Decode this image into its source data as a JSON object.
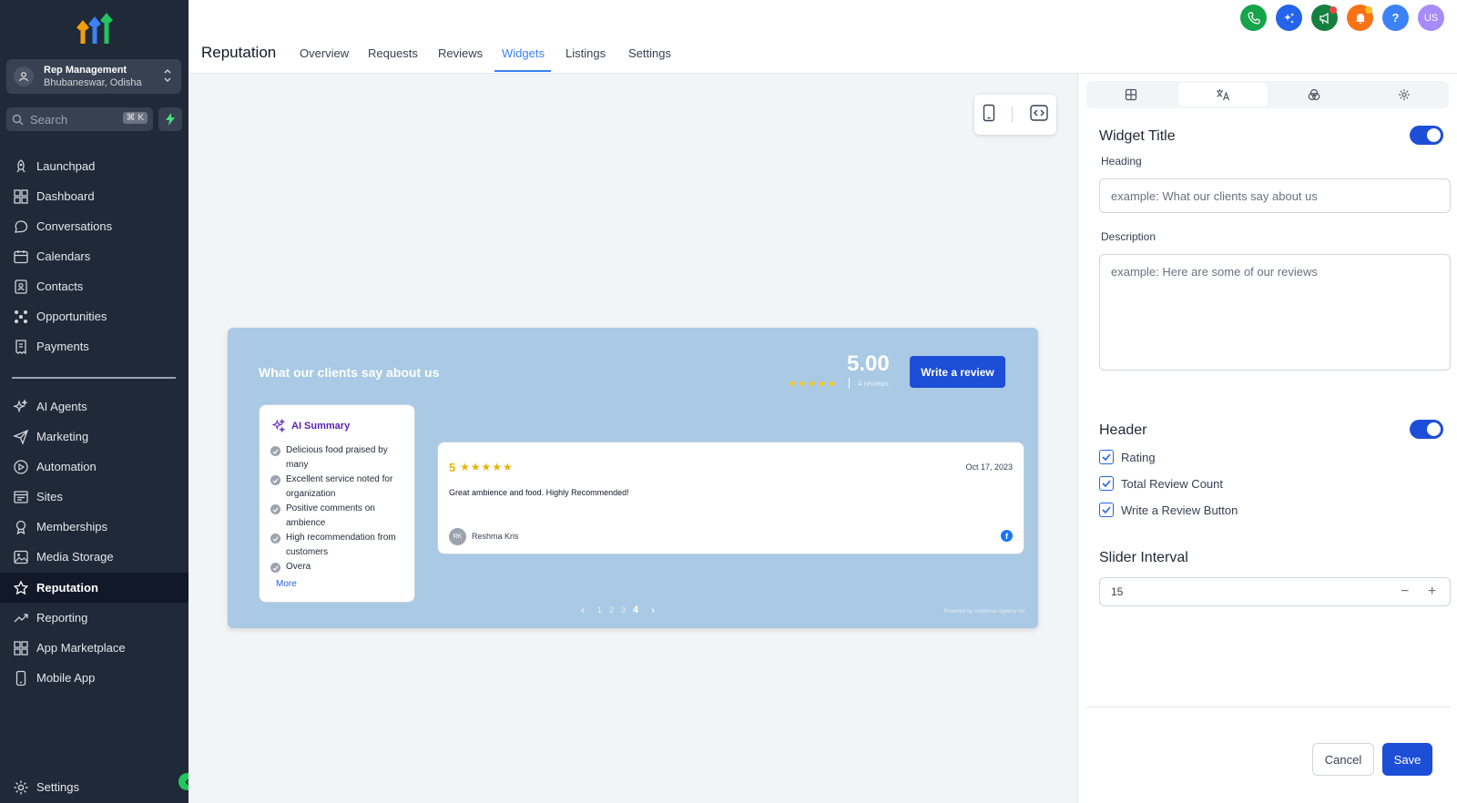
{
  "sidebar": {
    "location": {
      "name": "Rep Management",
      "sub": "Bhubaneswar, Odisha"
    },
    "search": {
      "placeholder": "Search",
      "shortcut": "⌘ K"
    },
    "items": [
      {
        "label": "Launchpad",
        "icon": "rocket-icon"
      },
      {
        "label": "Dashboard",
        "icon": "dashboard-icon"
      },
      {
        "label": "Conversations",
        "icon": "chat-icon"
      },
      {
        "label": "Calendars",
        "icon": "calendar-icon"
      },
      {
        "label": "Contacts",
        "icon": "contacts-icon"
      },
      {
        "label": "Opportunities",
        "icon": "opportunities-icon"
      },
      {
        "label": "Payments",
        "icon": "payments-icon"
      },
      {
        "label": "AI Agents",
        "icon": "sparkles-icon"
      },
      {
        "label": "Marketing",
        "icon": "send-icon"
      },
      {
        "label": "Automation",
        "icon": "automation-icon"
      },
      {
        "label": "Sites",
        "icon": "sites-icon"
      },
      {
        "label": "Memberships",
        "icon": "award-icon"
      },
      {
        "label": "Media Storage",
        "icon": "image-icon"
      },
      {
        "label": "Reputation",
        "icon": "star-icon",
        "active": true
      },
      {
        "label": "Reporting",
        "icon": "trend-icon"
      },
      {
        "label": "App Marketplace",
        "icon": "grid-icon"
      },
      {
        "label": "Mobile App",
        "icon": "phone-icon"
      }
    ],
    "settings": "Settings"
  },
  "header": {
    "title": "Reputation",
    "tabs": [
      "Overview",
      "Requests",
      "Reviews",
      "Widgets",
      "Listings",
      "Settings"
    ],
    "active_tab": "Widgets",
    "avatar": "US"
  },
  "widget": {
    "heading": "What our clients say about us",
    "rating": "5.00",
    "stars": "★★★★★",
    "review_count": "4 reviews",
    "write_button": "Write a review",
    "ai_summary": {
      "title": "AI Summary",
      "items": [
        "Delicious food praised by many",
        "Excellent service noted for organization",
        "Positive comments on ambience",
        "High recommendation from customers",
        "Overa"
      ],
      "more": "More"
    },
    "review": {
      "score": "5",
      "stars": "★★★★★",
      "date": "Oct 17, 2023",
      "text": "Great ambience and food. Highly Recommended!",
      "initials": "RK",
      "author": "Reshma Kris"
    },
    "pager": {
      "pages": [
        "1",
        "2",
        "3"
      ],
      "current": "4"
    },
    "powered": "Powered by Universal Agency Inc"
  },
  "panel": {
    "widget_title": {
      "label": "Widget Title",
      "enabled": true,
      "heading_label": "Heading",
      "heading_placeholder": "example: What our clients say about us",
      "description_label": "Description",
      "description_placeholder": "example: Here are some of our reviews"
    },
    "header_section": {
      "label": "Header",
      "enabled": true,
      "options": [
        "Rating",
        "Total Review Count",
        "Write a Review Button"
      ]
    },
    "slider": {
      "label": "Slider Interval",
      "value": "15"
    },
    "cancel": "Cancel",
    "save": "Save"
  }
}
